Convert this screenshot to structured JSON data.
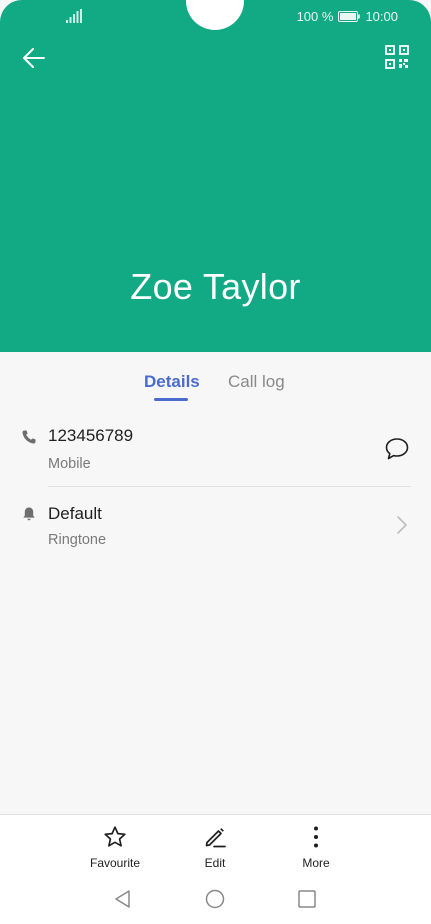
{
  "status_bar": {
    "battery_percent": "100 %",
    "time": "10:00"
  },
  "header": {
    "contact_name": "Zoe Taylor",
    "background_color": "#12a985"
  },
  "tabs": [
    {
      "label": "Details",
      "active": true
    },
    {
      "label": "Call log",
      "active": false
    }
  ],
  "details": {
    "phone": {
      "number": "123456789",
      "type": "Mobile"
    },
    "ringtone": {
      "value": "Default",
      "label": "Ringtone"
    }
  },
  "actions": [
    {
      "label": "Favourite",
      "icon": "star-icon"
    },
    {
      "label": "Edit",
      "icon": "pencil-icon"
    },
    {
      "label": "More",
      "icon": "more-vertical-icon"
    }
  ],
  "accent_color": "#4a6bd0"
}
